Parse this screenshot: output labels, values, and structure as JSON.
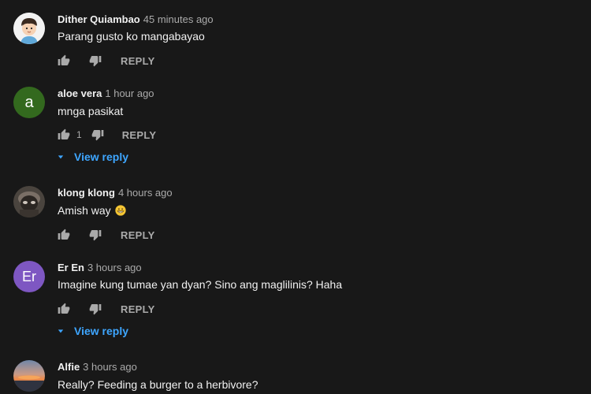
{
  "comments": [
    {
      "author": "Dither Quiambao",
      "time": "45 minutes ago",
      "text": "Parang gusto ko mangabayao",
      "likes": "",
      "reply_label": "REPLY",
      "avatar_icon": "cartoon-boy-avatar"
    },
    {
      "author": "aloe vera",
      "time": "1 hour ago",
      "text": "mnga pasikat",
      "likes": "1",
      "reply_label": "REPLY",
      "view_reply_label": "View reply",
      "avatar_letter": "a",
      "avatar_color": "#33691e"
    },
    {
      "author": "klong klong",
      "time": "4 hours ago",
      "text": "Amish way",
      "emoji": "grinning-face-emoji",
      "likes": "",
      "reply_label": "REPLY",
      "avatar_icon": "photo-avatar"
    },
    {
      "author": "Er En",
      "time": "3 hours ago",
      "text": "Imagine kung tumae yan dyan? Sino ang maglilinis? Haha",
      "likes": "",
      "reply_label": "REPLY",
      "view_reply_label": "View reply",
      "avatar_letter": "Er",
      "avatar_color": "#7e57c2"
    },
    {
      "author": "Alfie",
      "time": "3 hours ago",
      "text": "Really? Feeding a burger to a herbivore?",
      "avatar_icon": "sunset-photo-avatar"
    }
  ],
  "colors": {
    "background": "#181818",
    "primary_text": "#f1f1f1",
    "secondary_text": "#aaaaaa",
    "link_blue": "#3ea6ff"
  }
}
